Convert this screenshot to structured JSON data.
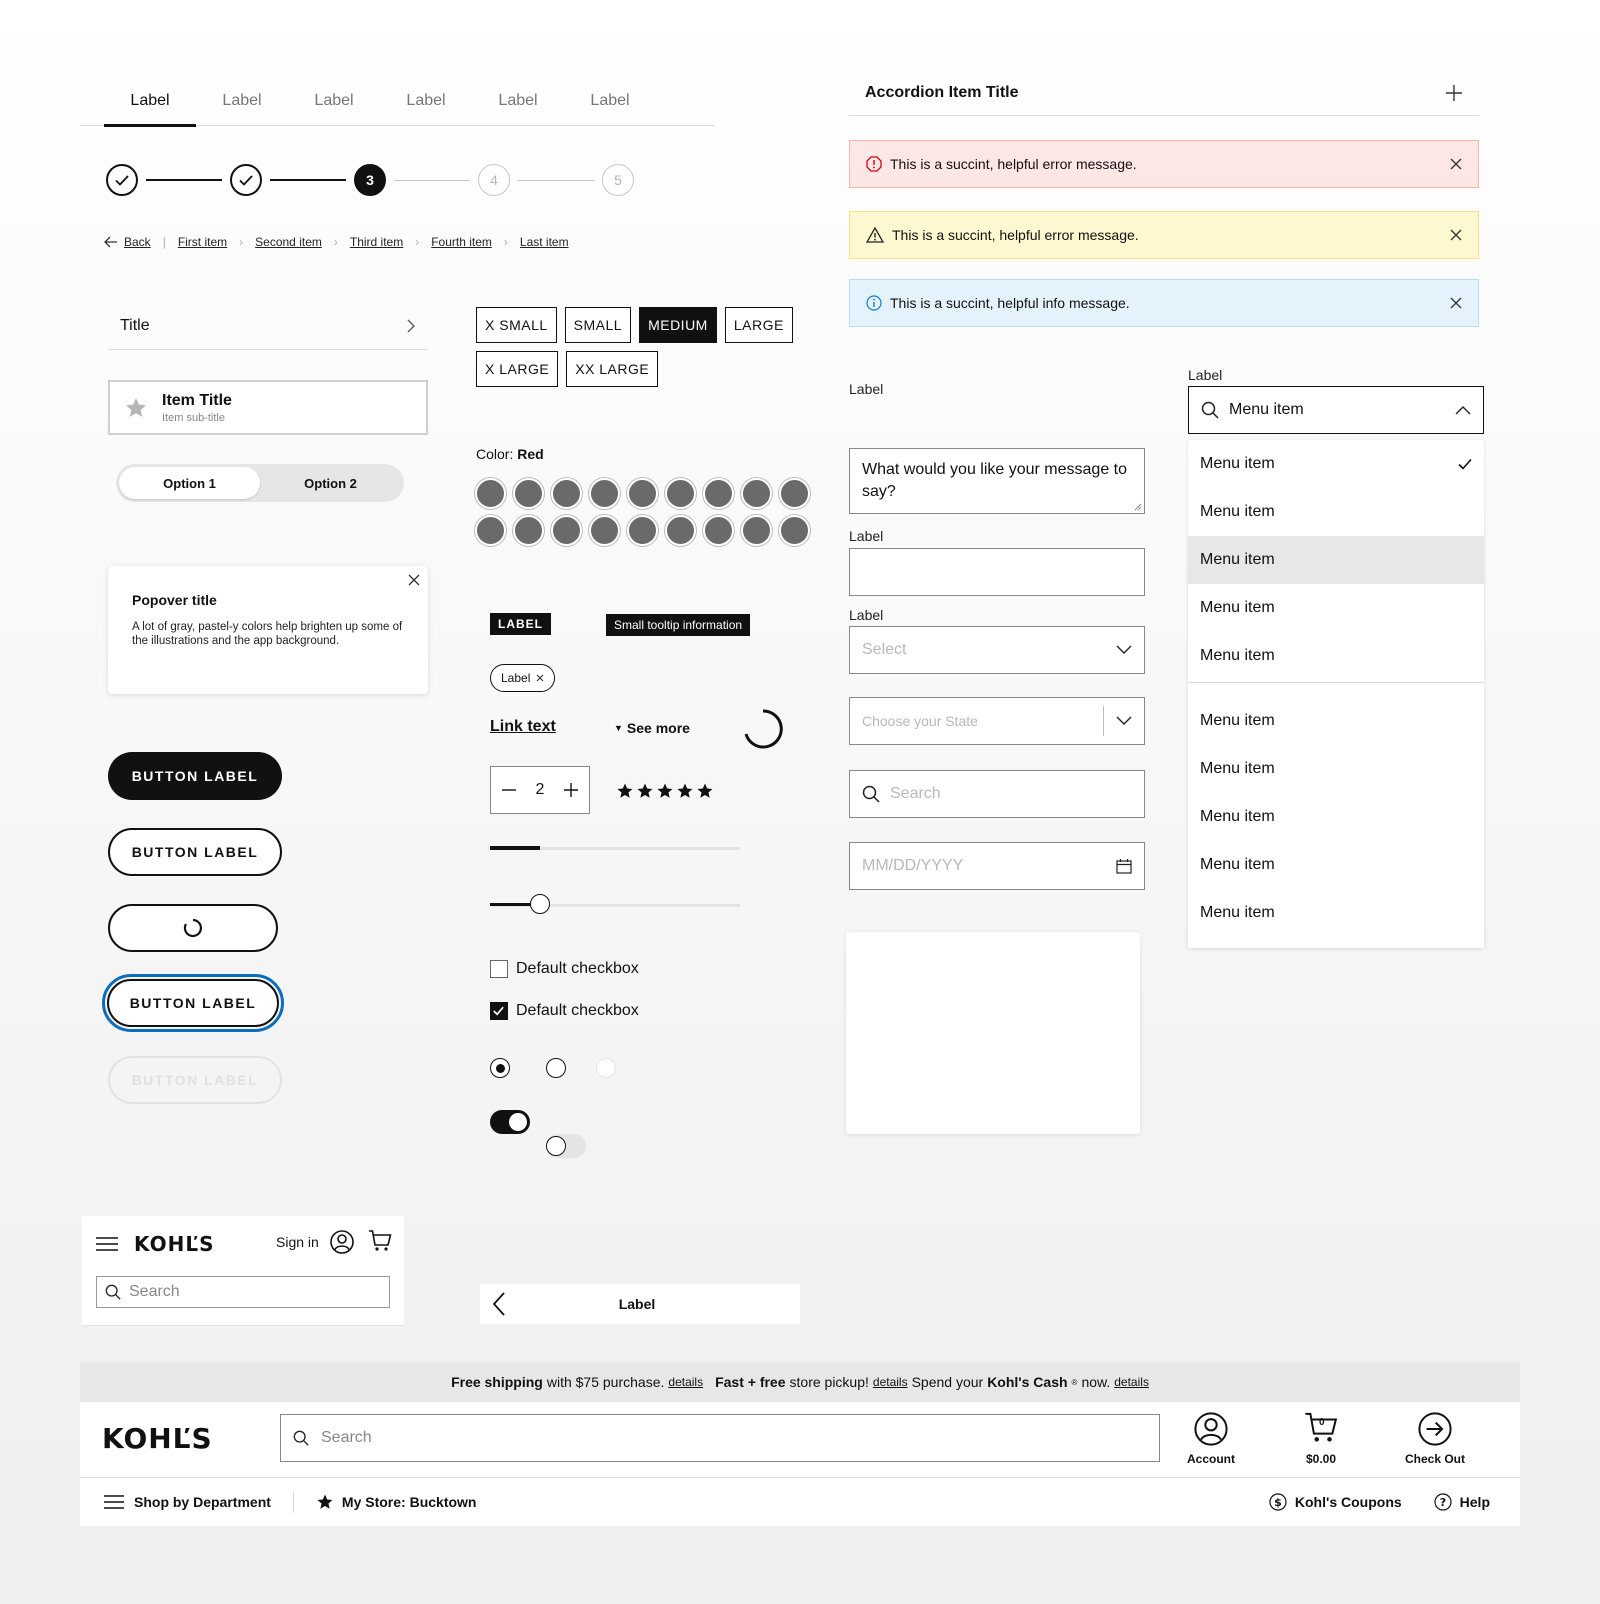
{
  "tabs": [
    "Label",
    "Label",
    "Label",
    "Label",
    "Label",
    "Label"
  ],
  "stepper": {
    "current": "3",
    "future": [
      "4",
      "5"
    ]
  },
  "breadcrumb": {
    "back": "Back",
    "items": [
      "First item",
      "Second item",
      "Third item",
      "Fourth item",
      "Last item"
    ]
  },
  "list_title": "Title",
  "item_card": {
    "title": "Item Title",
    "subtitle": "Item sub-title"
  },
  "segmented": {
    "options": [
      "Option 1",
      "Option 2"
    ]
  },
  "popover": {
    "title": "Popover title",
    "body": "A lot of gray, pastel-y colors help brighten up some of the illustrations and the app background."
  },
  "buttons": {
    "primary": "BUTTON LABEL",
    "secondary": "BUTTON LABEL",
    "focused": "BUTTON LABEL",
    "disabled": "BUTTON LABEL"
  },
  "sizes": {
    "row1": [
      "X SMALL",
      "SMALL",
      "MEDIUM",
      "LARGE"
    ],
    "row2": [
      "X LARGE",
      "XX LARGE"
    ],
    "selected": "MEDIUM"
  },
  "color": {
    "label": "Color: ",
    "value": "Red",
    "swatch_count": 18,
    "swatch_color": "#6a6a6a"
  },
  "badge": "LABEL",
  "tooltip": "Small tooltip information",
  "chip": "Label",
  "link_text": "Link text",
  "see_more": "See more",
  "quantity": "2",
  "rating": {
    "stars": 5,
    "max": 5
  },
  "progress": {
    "value": 0.2
  },
  "slider": {
    "value": 0.2
  },
  "checkboxes": [
    {
      "label": "Default checkbox",
      "checked": false
    },
    {
      "label": "Default checkbox",
      "checked": true
    }
  ],
  "accordion": {
    "title": "Accordion Item Title"
  },
  "alerts": {
    "error": "This is a succint, helpful error message.",
    "warning": "This is a succint, helpful error message.",
    "info": "This is a succint, helpful info message."
  },
  "form": {
    "textarea_label": "Label",
    "textarea_value": "What would you like your message to say?",
    "input_label": "Label",
    "select_label": "Label",
    "select_placeholder": "Select",
    "state_placeholder": "Choose your State",
    "search_placeholder": "Search",
    "date_placeholder": "MM/DD/YYYY"
  },
  "combobox": {
    "label": "Label",
    "value": "Menu item",
    "items": [
      "Menu item",
      "Menu item",
      "Menu item",
      "Menu item",
      "Menu item"
    ],
    "items2": [
      "Menu item",
      "Menu item",
      "Menu item",
      "Menu item",
      "Menu item"
    ]
  },
  "mobile_header": {
    "logo": "KOHĽS",
    "sign_in": "Sign in",
    "search_placeholder": "Search"
  },
  "nav_bar": {
    "label": "Label"
  },
  "promo": {
    "p1_bold": "Free shipping",
    "p1": "with $75 purchase.",
    "details": "details",
    "p2_bold": "Fast + free",
    "p2": "store pickup!",
    "p3": "Spend your",
    "p3_bold": "Kohl's Cash",
    "p3_sup": "®",
    "p3_end": "now."
  },
  "desktop_header": {
    "logo": "KOHĽS",
    "search_placeholder": "Search",
    "account": "Account",
    "cart_amount": "$0.00",
    "cart_count": "0",
    "checkout": "Check Out"
  },
  "desktop_nav": {
    "shop": "Shop by Department",
    "store": "My Store: Bucktown",
    "coupons": "Kohl's Coupons",
    "help": "Help"
  },
  "colors": {
    "accent_focus": "#0a6ebd",
    "error_bg": "#fde7e5",
    "warn_bg": "#fdf8cf",
    "info_bg": "#e4f2fb",
    "error_icon": "#d0021b",
    "info_icon": "#1a7cc6"
  }
}
